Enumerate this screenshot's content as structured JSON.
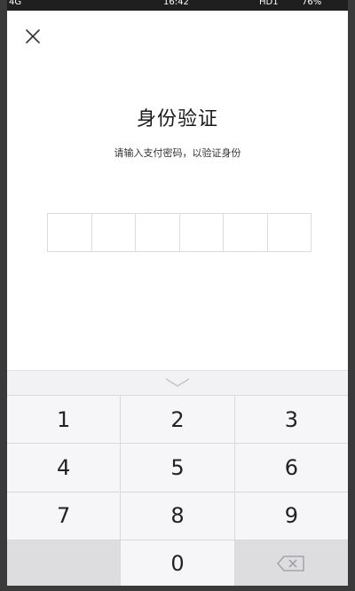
{
  "status_bar": {
    "network": "4G",
    "time": "16:42",
    "hd": "HD1",
    "battery": "76%"
  },
  "header": {
    "close_icon": "close-icon"
  },
  "main": {
    "title": "身份验证",
    "subtitle": "请输入支付密码，以验证身份",
    "pin_length": 6
  },
  "keyboard": {
    "collapse_icon": "chevron-down-icon",
    "keys": [
      "1",
      "2",
      "3",
      "4",
      "5",
      "6",
      "7",
      "8",
      "9",
      "",
      "0",
      "backspace-icon"
    ]
  },
  "colors": {
    "keyboard_bg": "#f2f2f4",
    "key_bg": "#f6f6f8",
    "special_key_bg": "#dddde0",
    "text": "#1a1a1a"
  }
}
